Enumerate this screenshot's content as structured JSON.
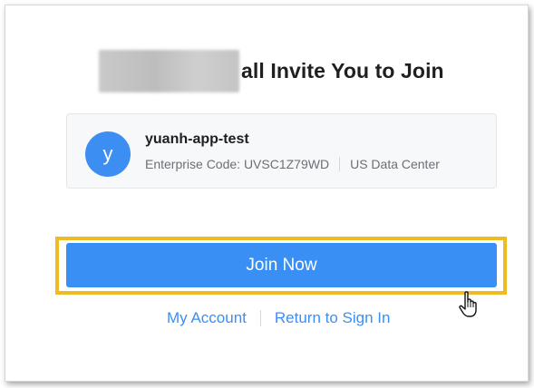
{
  "invite": {
    "title_text": "all Invite You to Join"
  },
  "company": {
    "avatar_letter": "y",
    "name": "yuanh-app-test",
    "enterprise_code": "Enterprise Code: UVSC1Z79WD",
    "data_center": "US Data Center"
  },
  "actions": {
    "join_label": "Join Now",
    "my_account_label": "My Account",
    "return_label": "Return to Sign In"
  },
  "colors": {
    "accent": "#3a8ff5",
    "highlight": "#eebb22",
    "avatar": "#3d8ef2"
  },
  "icons": {
    "cursor": "hand-pointer-icon"
  }
}
